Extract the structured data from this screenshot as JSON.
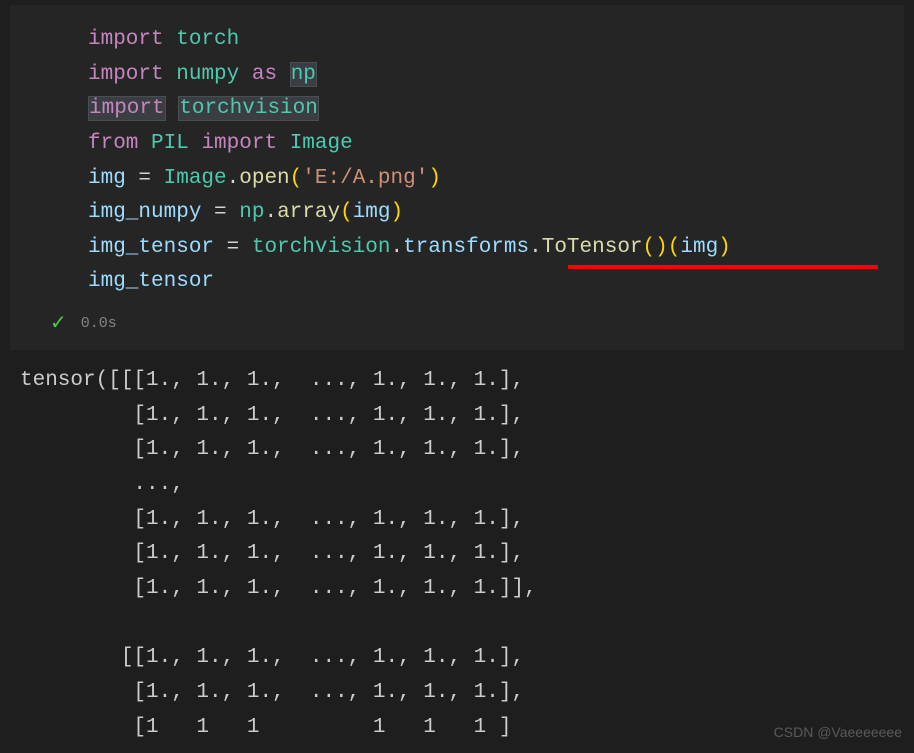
{
  "code": {
    "line1": {
      "kw": "import",
      "module": "torch"
    },
    "line2": {
      "kw": "import",
      "module": "numpy",
      "as": "as",
      "alias": "np"
    },
    "line3": {
      "kw": "import",
      "module": "torchvision"
    },
    "line4": {
      "kw": "from",
      "module": "PIL",
      "import": "import",
      "class": "Image"
    },
    "line5": {
      "var": "img",
      "eq": " = ",
      "class": "Image",
      "dot": ".",
      "func": "open",
      "open": "(",
      "str": "'E:/A.png'",
      "close": ")"
    },
    "line6": {
      "var": "img_numpy",
      "eq": " = ",
      "module": "np",
      "dot": ".",
      "func": "array",
      "open": "(",
      "arg": "img",
      "close": ")"
    },
    "line7": {
      "var": "img_tensor",
      "eq": " = ",
      "module": "torchvision",
      "dot1": ".",
      "attr1": "transforms",
      "dot2": ".",
      "func": "ToTensor",
      "call1": "()(",
      "arg": "img",
      "call2": ")"
    },
    "line8": {
      "var": "img_tensor"
    }
  },
  "status": {
    "timing": "0.0s"
  },
  "output": {
    "lines": [
      "tensor([[[1., 1., 1.,  ..., 1., 1., 1.],",
      "         [1., 1., 1.,  ..., 1., 1., 1.],",
      "         [1., 1., 1.,  ..., 1., 1., 1.],",
      "         ...,",
      "         [1., 1., 1.,  ..., 1., 1., 1.],",
      "         [1., 1., 1.,  ..., 1., 1., 1.],",
      "         [1., 1., 1.,  ..., 1., 1., 1.]],",
      "",
      "        [[1., 1., 1.,  ..., 1., 1., 1.],",
      "         [1., 1., 1.,  ..., 1., 1., 1.],",
      "         [1   1   1         1   1   1 ]"
    ]
  },
  "watermark": "CSDN @Vaeeeeeee"
}
